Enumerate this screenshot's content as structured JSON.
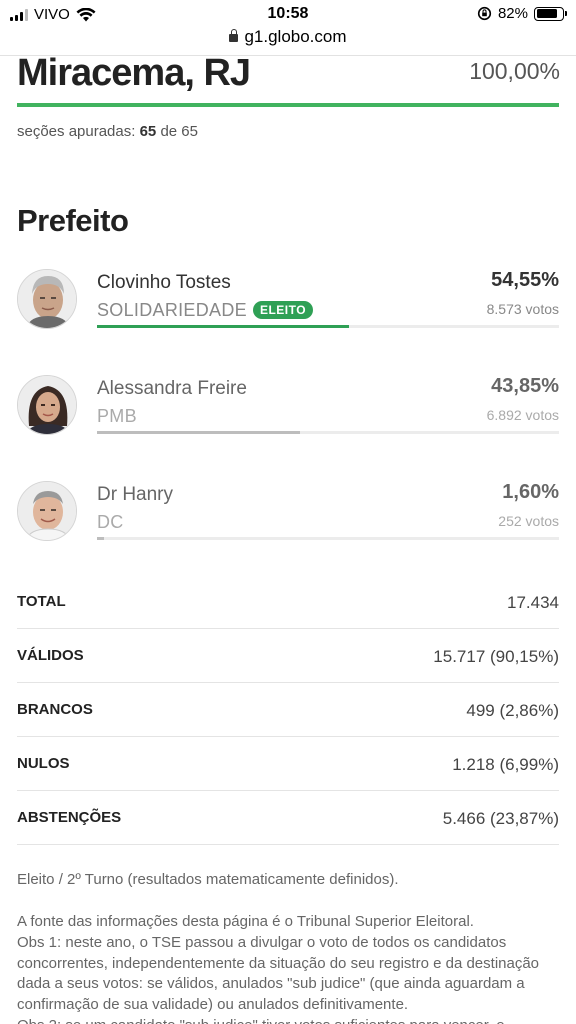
{
  "status_bar": {
    "carrier": "VIVO",
    "time": "10:58",
    "battery": "82%",
    "battery_fraction": 0.82
  },
  "browser": {
    "url": "g1.globo.com"
  },
  "header": {
    "city": "Miracema, RJ",
    "percent_counted": "100,00%",
    "progress_fraction": 1.0,
    "sections_label": "seções apuradas:",
    "sections_counted": "65",
    "sections_of": "de 65"
  },
  "office": "Prefeito",
  "candidates": [
    {
      "name": "Clovinho Tostes",
      "party": "SOLIDARIEDADE",
      "badge": "ELEITO",
      "percent": "54,55%",
      "votes": "8.573 votos",
      "share": 0.5455,
      "bar_color": "#2fa055",
      "photo": "candidate-photo-icon"
    },
    {
      "name": "Alessandra Freire",
      "party": "PMB",
      "percent": "43,85%",
      "votes": "6.892 votos",
      "share": 0.4385,
      "bar_color": "#bdbdbd",
      "photo": "candidate-photo-icon"
    },
    {
      "name": "Dr Hanry",
      "party": "DC",
      "percent": "1,60%",
      "votes": "252 votos",
      "share": 0.016,
      "bar_color": "#bdbdbd",
      "photo": "candidate-photo-icon"
    }
  ],
  "totals": [
    {
      "label": "TOTAL",
      "value": "17.434"
    },
    {
      "label": "VÁLIDOS",
      "value": "15.717 (90,15%)"
    },
    {
      "label": "BRANCOS",
      "value": "499 (2,86%)"
    },
    {
      "label": "NULOS",
      "value": "1.218 (6,99%)"
    },
    {
      "label": "ABSTENÇÕES",
      "value": "5.466 (23,87%)"
    }
  ],
  "footnote": "Eleito / 2º Turno (resultados matematicamente definidos).",
  "source_lines": [
    "A fonte das informações desta página é o Tribunal Superior Eleitoral.",
    "Obs 1: neste ano, o TSE passou a divulgar o voto de todos os candidatos concorrentes, independentemente da situação do seu registro e da destinação dada a seus votos: se válidos, anulados \"sub judice\" (que ainda aguardam a confirmação de sua validade) ou anulados definitivamente.",
    "Obs 2: se um candidato \"sub judice\" tiver votos suficientes para vencer, o"
  ]
}
